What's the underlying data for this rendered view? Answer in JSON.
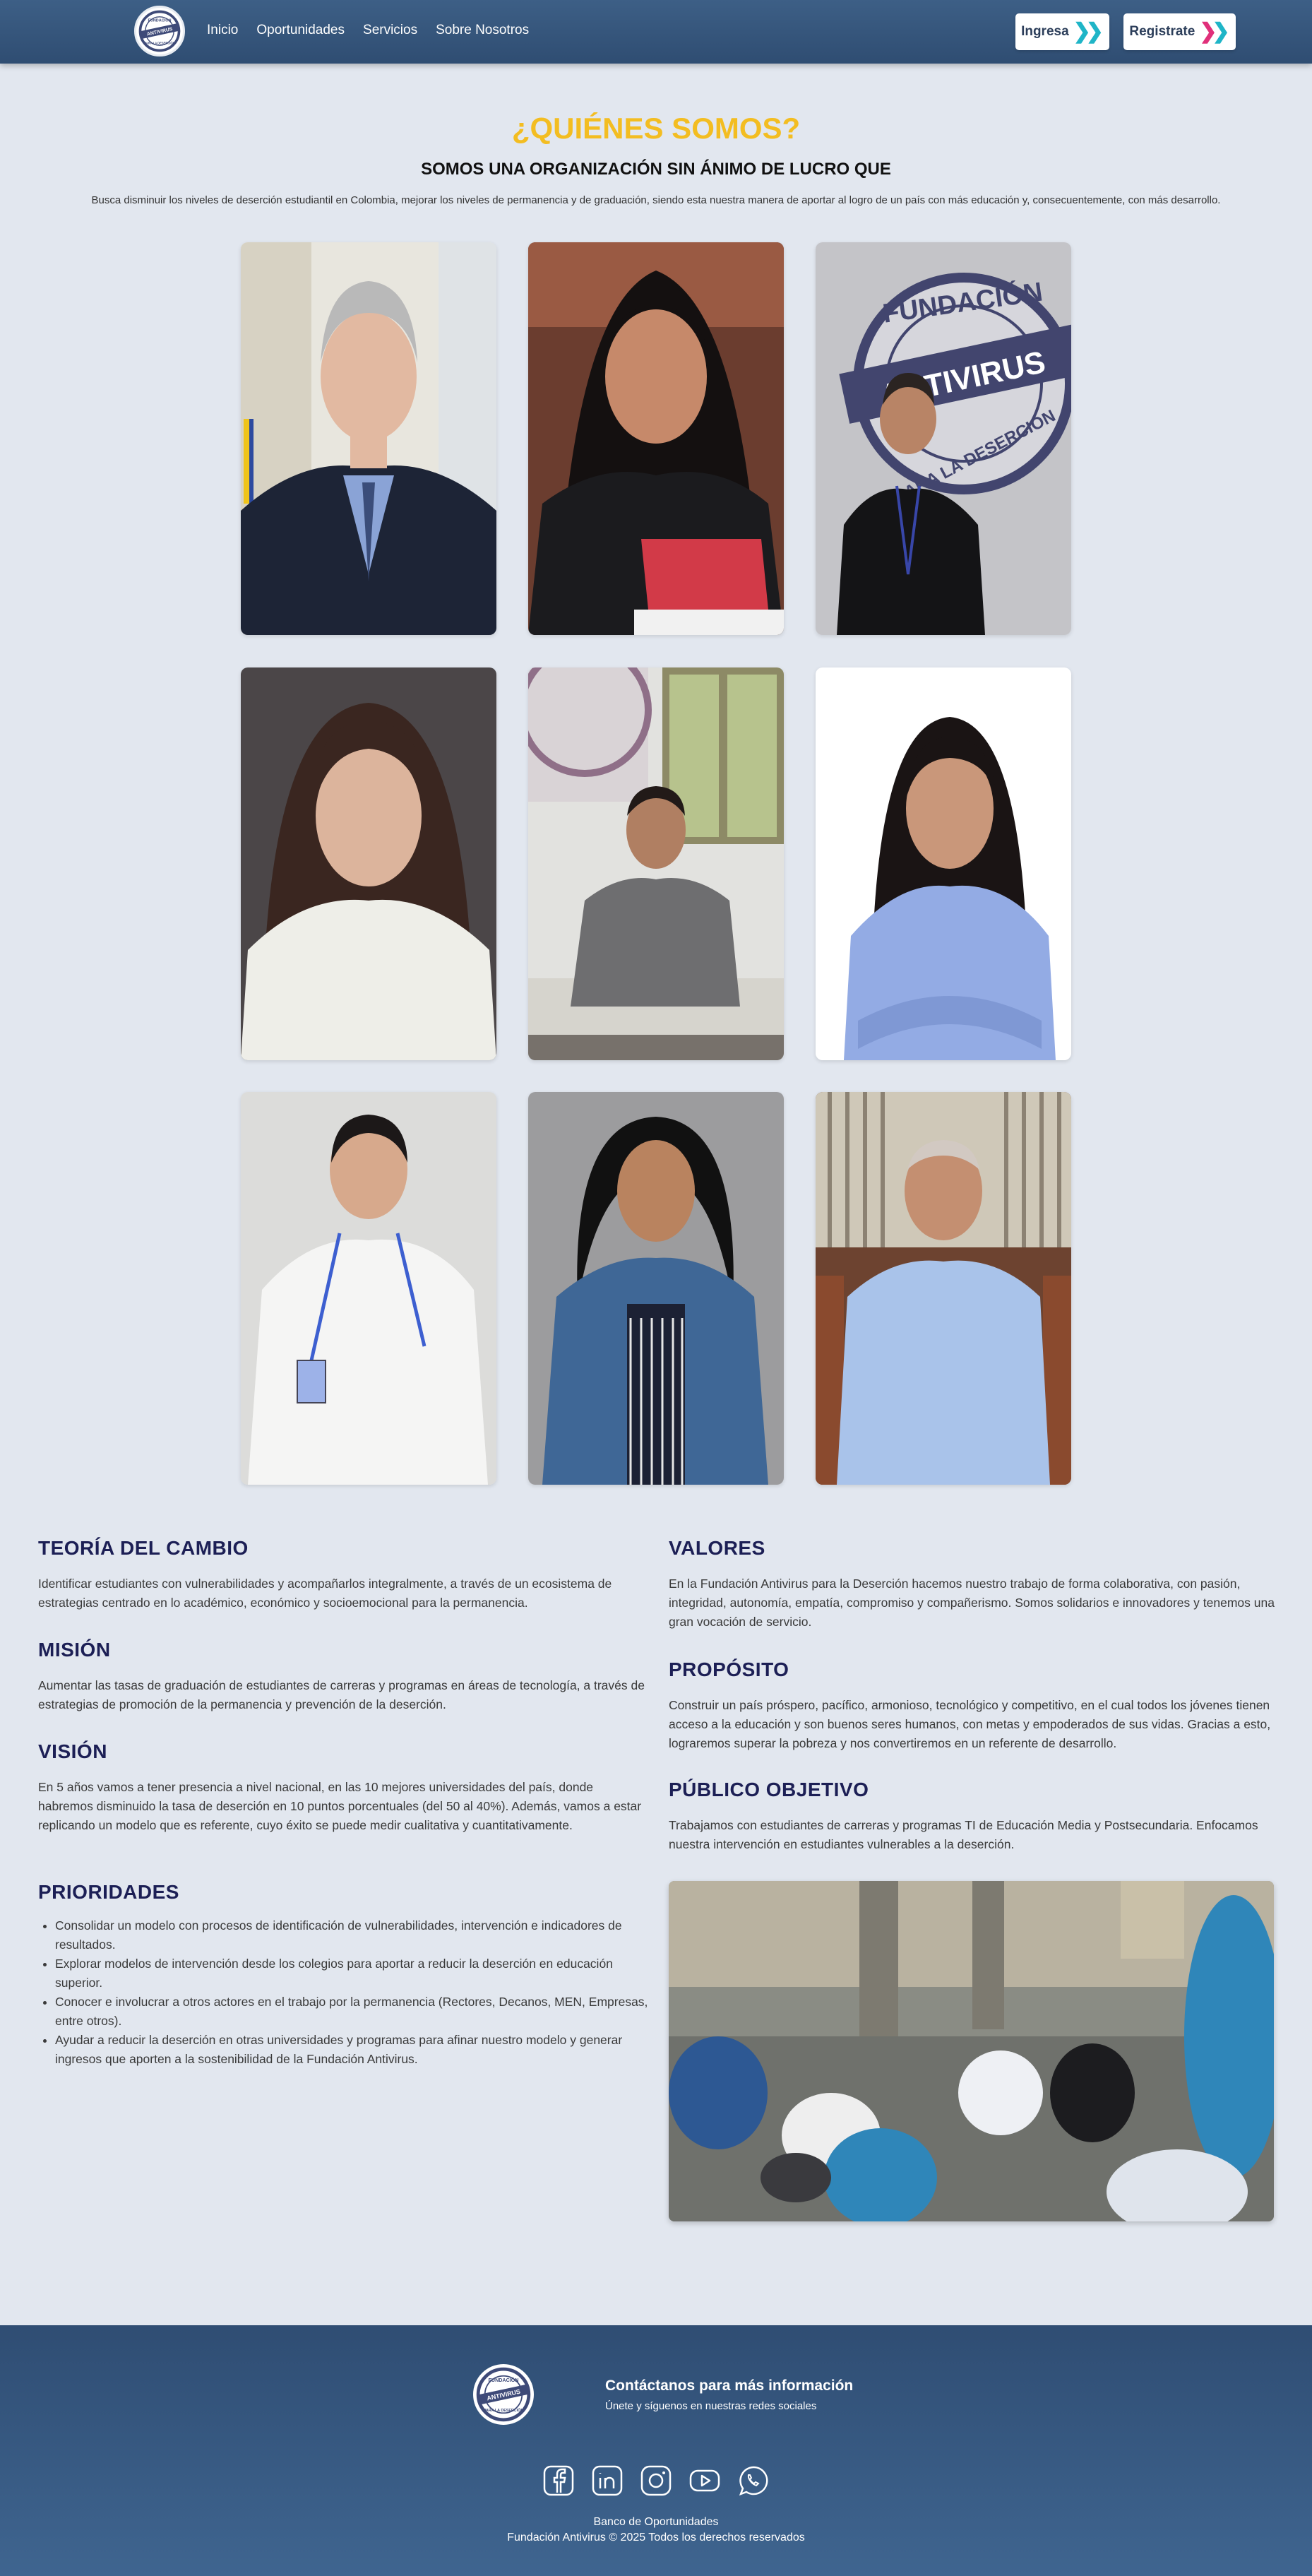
{
  "nav": {
    "logo_text_top": "FUNDACIÓN",
    "logo_text_mid": "ANTIVIRUS",
    "logo_text_bottom": "PARA LA DESERCIÓN",
    "links": [
      "Inicio",
      "Oportunidades",
      "Servicios",
      "Sobre Nosotros"
    ],
    "login_label": "Ingresa",
    "register_label": "Registrate"
  },
  "hero": {
    "title": "¿QUIÉNES SOMOS?",
    "subtitle": "SOMOS UNA ORGANIZACIÓN SIN ÁNIMO DE LUCRO QUE",
    "description": "Busca disminuir los niveles de deserción estudiantil en Colombia, mejorar los niveles de permanencia y de graduación, siendo esta nuestra manera de aportar al logro de un país con más educación y, consecuentemente, con más desarrollo."
  },
  "team_photo_sign": {
    "top": "FUNDACIÓN",
    "mid": "ANTIVIRUS",
    "bottom": "PARA LA DESERCIÓN"
  },
  "sections": {
    "teoria": {
      "title": "TEORÍA DEL CAMBIO",
      "text": "Identificar estudiantes con vulnerabilidades y acompañarlos integralmente, a través de un ecosistema de estrategias centrado en lo académico, económico y socioemocional para la permanencia."
    },
    "mision": {
      "title": "MISIÓN",
      "text": "Aumentar las tasas de graduación de estudiantes de carreras y programas en áreas de tecnología, a través de estrategias de promoción de la permanencia y prevención de la deserción."
    },
    "vision": {
      "title": "VISIÓN",
      "text": "En 5 años vamos a tener presencia a nivel nacional, en las 10 mejores universidades del país, donde habremos disminuido la tasa de deserción en 10 puntos porcentuales (del 50 al 40%). Además, vamos a estar replicando un modelo que es referente, cuyo éxito se puede medir cualitativa y cuantitativamente."
    },
    "prioridades": {
      "title": "PRIORIDADES",
      "items": [
        "Consolidar un modelo con procesos de identificación de vulnerabilidades, intervención e indicadores de resultados.",
        "Explorar modelos de intervención desde los colegios para aportar a reducir la deserción en educación superior.",
        "Conocer e involucrar a otros actores en el trabajo por la permanencia (Rectores, Decanos, MEN, Empresas, entre otros).",
        "Ayudar a reducir la deserción en otras universidades y programas para afinar nuestro modelo y generar ingresos que aporten a la sostenibilidad de la Fundación Antivirus."
      ]
    },
    "valores": {
      "title": "VALORES",
      "text": "En la Fundación Antivirus para la Deserción hacemos nuestro trabajo de forma colaborativa, con pasión, integridad, autonomía, empatía, compromiso y compañerismo. Somos solidarios e innovadores y tenemos una gran vocación de servicio."
    },
    "proposito": {
      "title": "PROPÓSITO",
      "text": "Construir un país próspero, pacífico, armonioso, tecnológico y competitivo, en el cual todos los jóvenes tienen acceso a la educación y son buenos seres humanos, con metas y empoderados de sus vidas. Gracias a esto, lograremos superar la pobreza y nos convertiremos en un referente de desarrollo."
    },
    "publico": {
      "title": "PÚBLICO OBJETIVO",
      "text": "Trabajamos con estudiantes de carreras y programas TI de Educación Media y Postsecundaria. Enfocamos nuestra intervención en estudiantes vulnerables a la deserción."
    }
  },
  "footer": {
    "contact_title": "Contáctanos para más información",
    "follow_text": "Únete y síguenos en nuestras redes sociales",
    "social_icons": [
      "facebook-icon",
      "linkedin-icon",
      "instagram-icon",
      "youtube-icon",
      "whatsapp-icon"
    ],
    "line1": "Banco de Oportunidades",
    "line2": "Fundación Antivirus © 2025 Todos los derechos reservados"
  },
  "colors": {
    "accent_yellow": "#f3bd21",
    "heading_navy": "#1c1f55",
    "nav_blue": "#34547a",
    "chevron_teal": "#1fb5c7",
    "chevron_pink": "#e0307a"
  }
}
